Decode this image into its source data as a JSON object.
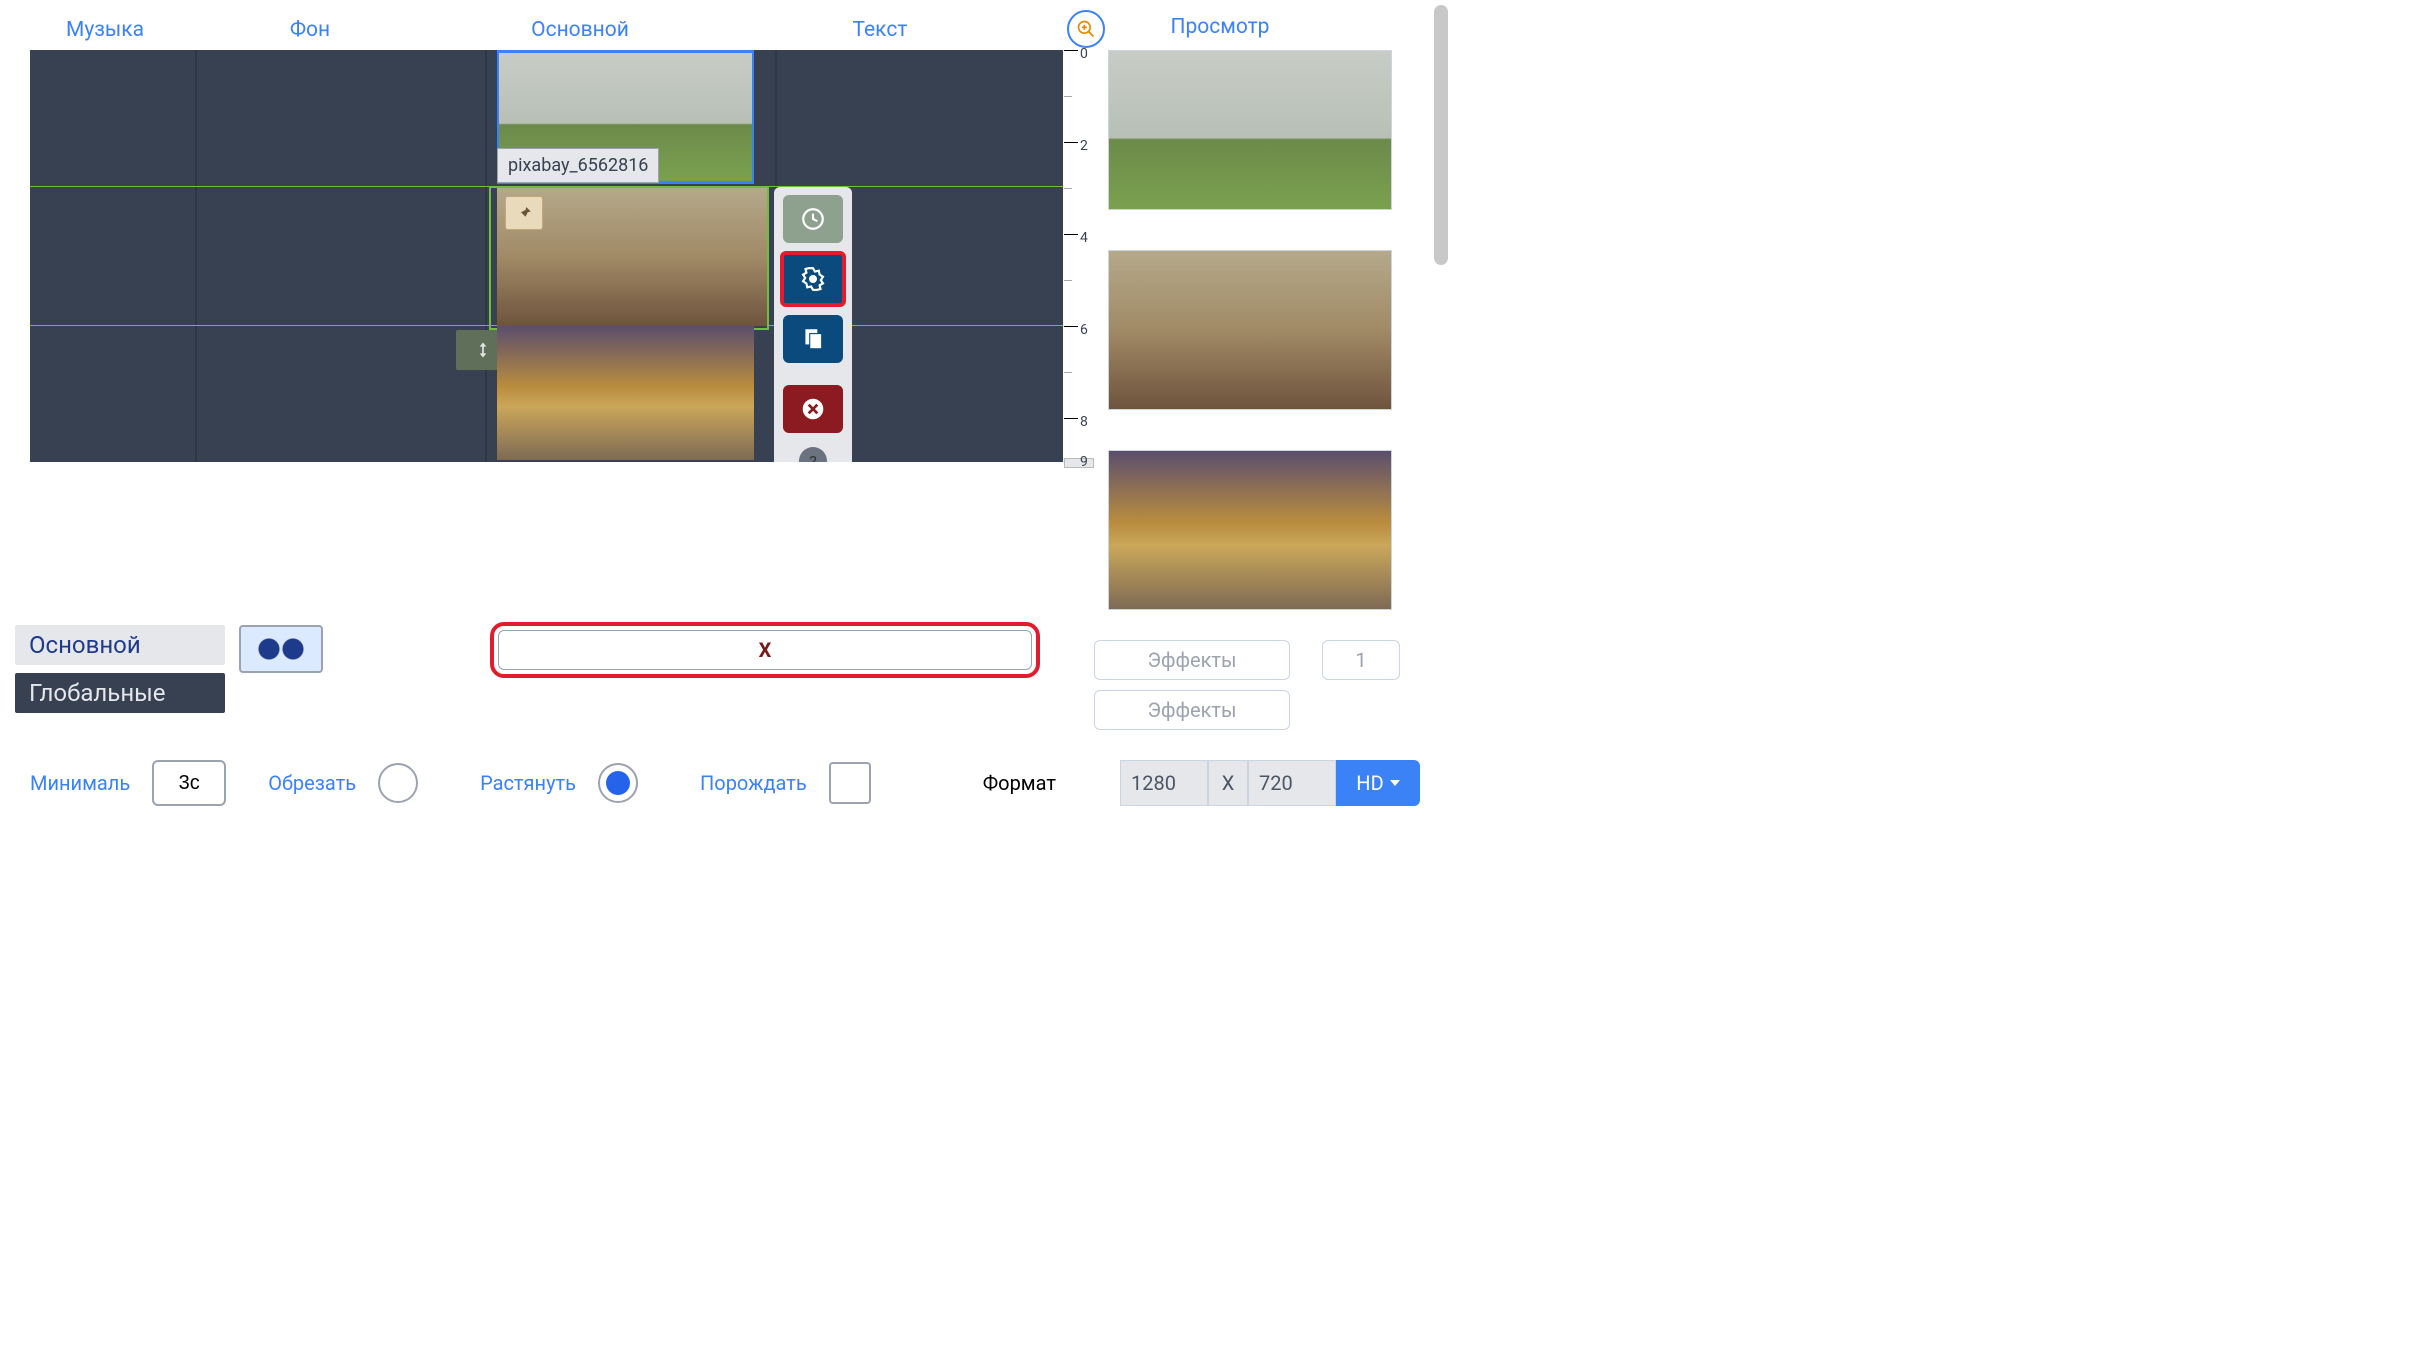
{
  "tabs": {
    "music": "Музыка",
    "background": "Фон",
    "main": "Основной",
    "text": "Текст",
    "preview": "Просмотр"
  },
  "timeline": {
    "clip1_label": "pixabay_6562816",
    "ruler_ticks": [
      "0",
      "2",
      "4",
      "6",
      "8",
      "9"
    ]
  },
  "context_toolbar": {
    "help": "?"
  },
  "mid": {
    "chip_main": "Основной",
    "chip_global": "Глобальные",
    "x_button": "X",
    "effects_label": "Эффекты",
    "effects_count": "1"
  },
  "bottom": {
    "min_label": "Минималь",
    "min_value": "3с",
    "crop_label": "Обрезать",
    "stretch_label": "Растянуть",
    "spawn_label": "Порождать",
    "format_label": "Формат",
    "width": "1280",
    "sep": "X",
    "height": "720",
    "hd": "HD"
  }
}
